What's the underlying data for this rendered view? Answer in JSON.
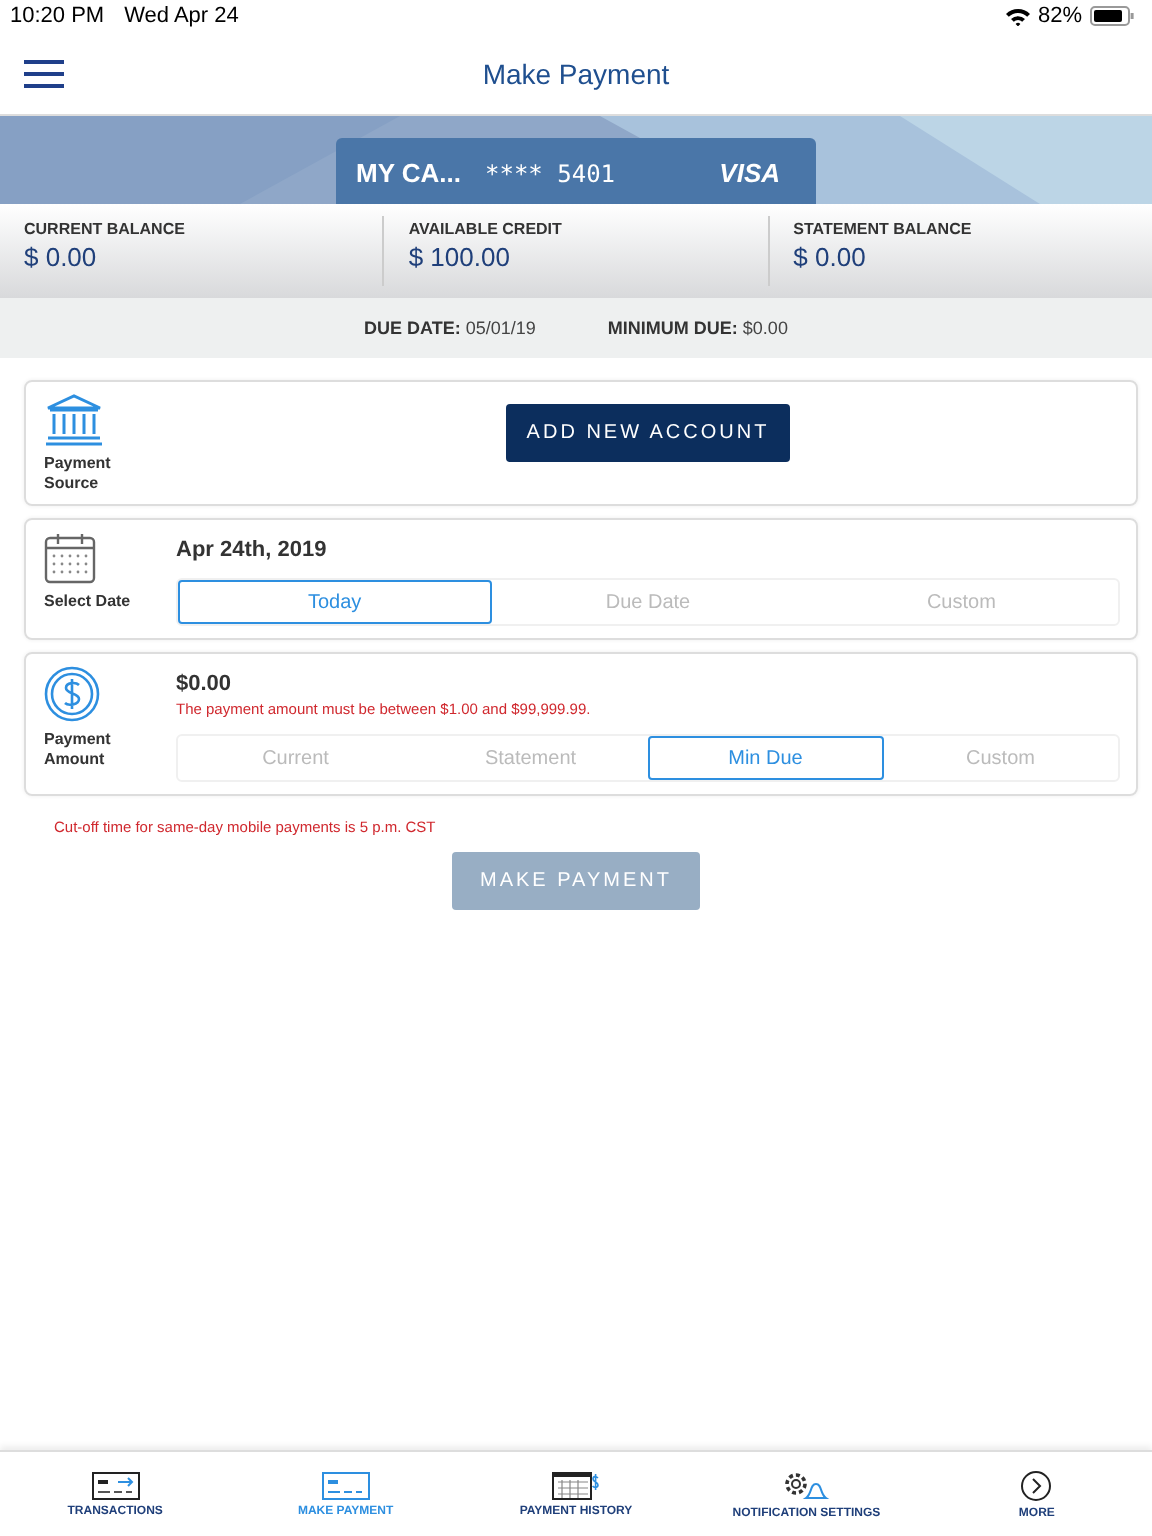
{
  "status_bar": {
    "time": "10:20 PM",
    "date": "Wed Apr 24",
    "battery_text": "82%"
  },
  "header": {
    "title": "Make Payment"
  },
  "card": {
    "name": "MY CA...",
    "number": "**** 5401",
    "network": "VISA"
  },
  "balances": [
    {
      "label": "CURRENT BALANCE",
      "value": "$ 0.00"
    },
    {
      "label": "AVAILABLE CREDIT",
      "value": "$ 100.00"
    },
    {
      "label": "STATEMENT BALANCE",
      "value": "$ 0.00"
    }
  ],
  "due": {
    "due_date_label": "DUE DATE:",
    "due_date": "05/01/19",
    "minimum_label": "MINIMUM DUE:",
    "minimum": "$0.00"
  },
  "payment_source": {
    "label": "Payment Source",
    "button": "ADD NEW ACCOUNT"
  },
  "select_date": {
    "label": "Select Date",
    "date": "Apr 24th, 2019",
    "options": [
      {
        "label": "Today",
        "selected": true
      },
      {
        "label": "Due Date",
        "selected": false
      },
      {
        "label": "Custom",
        "selected": false
      }
    ]
  },
  "payment_amount": {
    "label": "Payment Amount",
    "amount": "$0.00",
    "error": "The payment amount must be between $1.00 and $99,999.99.",
    "options": [
      {
        "label": "Current",
        "selected": false
      },
      {
        "label": "Statement",
        "selected": false
      },
      {
        "label": "Min Due",
        "selected": true
      },
      {
        "label": "Custom",
        "selected": false
      }
    ]
  },
  "cutoff_note": "Cut-off time for same-day mobile payments is 5 p.m. CST",
  "submit": {
    "label": "MAKE PAYMENT",
    "disabled": true
  },
  "tab_bar": [
    {
      "label": "TRANSACTIONS",
      "kind": "transactions",
      "selected": false
    },
    {
      "label": "MAKE PAYMENT",
      "kind": "card",
      "selected": true
    },
    {
      "label": "PAYMENT HISTORY",
      "kind": "history",
      "selected": false
    },
    {
      "label": "NOTIFICATION SETTINGS",
      "kind": "settings",
      "selected": false
    },
    {
      "label": "MORE",
      "kind": "more",
      "selected": false
    }
  ]
}
